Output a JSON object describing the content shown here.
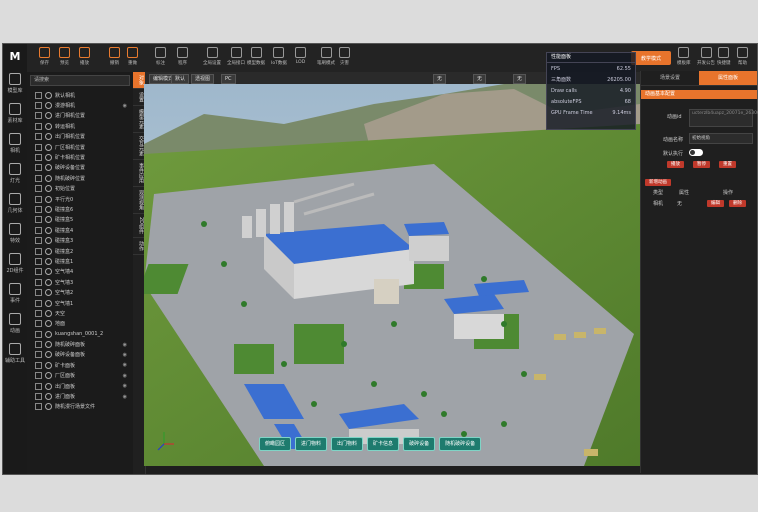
{
  "brand": {
    "logo": "M"
  },
  "rail": [
    {
      "label": "模型库",
      "icon": "cube-icon"
    },
    {
      "label": "素材库",
      "icon": "box-icon"
    },
    {
      "label": "相机",
      "icon": "camera-icon"
    },
    {
      "label": "灯光",
      "icon": "light-icon"
    },
    {
      "label": "几何体",
      "icon": "shape-icon"
    },
    {
      "label": "特效",
      "icon": "effect-icon"
    },
    {
      "label": "2D组件",
      "icon": "widget-icon"
    },
    {
      "label": "事件",
      "icon": "event-icon"
    },
    {
      "label": "动画",
      "icon": "animation-icon"
    },
    {
      "label": "辅助工具",
      "icon": "tool-icon"
    }
  ],
  "toolbar": {
    "items": [
      "保存",
      "预览",
      "播放",
      "撤销",
      "重做",
      "标注",
      "程序",
      "全局设置",
      "全局接口",
      "模型数据",
      "IoT数据",
      "LOD",
      "笔刷模式",
      "灾害"
    ],
    "teach_mode": "教学模式",
    "right_items": [
      "模板库",
      "开发公告",
      "快捷键",
      "帮助"
    ]
  },
  "tree": {
    "search_placeholder": "请搜索",
    "rows": [
      {
        "label": "默认相机",
        "eye": false
      },
      {
        "label": "漫游相机",
        "eye": true
      },
      {
        "label": "进门相机位置",
        "eye": false
      },
      {
        "label": "转运相机",
        "eye": false
      },
      {
        "label": "出门相机位置",
        "eye": false
      },
      {
        "label": "厂区相机位置",
        "eye": false
      },
      {
        "label": "矿卡相机位置",
        "eye": false
      },
      {
        "label": "破碎设备位置",
        "eye": false
      },
      {
        "label": "随机破碎位置",
        "eye": false
      },
      {
        "label": "初始位置",
        "eye": false
      },
      {
        "label": "平行光0",
        "eye": false
      },
      {
        "label": "碰撞盒6",
        "eye": false
      },
      {
        "label": "碰撞盒5",
        "eye": false
      },
      {
        "label": "碰撞盒4",
        "eye": false
      },
      {
        "label": "碰撞盒3",
        "eye": false
      },
      {
        "label": "碰撞盒2",
        "eye": false
      },
      {
        "label": "碰撞盒1",
        "eye": false
      },
      {
        "label": "空气墙4",
        "eye": false
      },
      {
        "label": "空气墙3",
        "eye": false
      },
      {
        "label": "空气墙2",
        "eye": false
      },
      {
        "label": "空气墙1",
        "eye": false
      },
      {
        "label": "天空",
        "eye": false
      },
      {
        "label": "地面",
        "eye": false
      },
      {
        "label": "kuangshan_0001_2",
        "eye": false
      },
      {
        "label": "随机破碎面板",
        "eye": true
      },
      {
        "label": "破碎设备面板",
        "eye": true
      },
      {
        "label": "矿卡面板",
        "eye": true
      },
      {
        "label": "厂区面板",
        "eye": true
      },
      {
        "label": "出门面板",
        "eye": true
      },
      {
        "label": "进门面板",
        "eye": true
      },
      {
        "label": "随机漫行场景文件",
        "eye": false
      }
    ]
  },
  "vtabs": [
    "对象",
    "设置",
    "模型元素",
    "交互元素",
    "事件应用",
    "观测视角",
    "2D组件",
    "动作"
  ],
  "viewbar": {
    "items": [
      "编辑模式",
      "默认",
      "透视图",
      "PC"
    ],
    "right_labels": [
      "无",
      "无",
      "无"
    ]
  },
  "stats": {
    "title": "性能面板",
    "rows": [
      {
        "k": "FPS",
        "v": "62.55"
      },
      {
        "k": "三角面数",
        "v": "26205.00"
      },
      {
        "k": "Draw calls",
        "v": "4.90"
      },
      {
        "k": "absoluteFPS",
        "v": "68"
      },
      {
        "k": "GPU Frame Time",
        "v": "9.14ms"
      }
    ]
  },
  "nav_buttons": [
    "俯瞰园区",
    "进门物料",
    "出门物料",
    "矿卡信息",
    "破碎设备",
    "随机破碎设备"
  ],
  "props": {
    "tabs": [
      "场景设置",
      "属性面板"
    ],
    "section": "动画基本配置",
    "anim_id_label": "动画id",
    "anim_id_value": "ucterzIb4uapz_20071e_2630682",
    "anim_name_label": "动画名称",
    "anim_name_value": "初始视角",
    "default_exec_label": "默认执行",
    "action_buttons": [
      "播放",
      "暂停",
      "重置"
    ],
    "add_anim": "新增动画",
    "table_headers": [
      "类型",
      "属性",
      "操作"
    ],
    "table_row": {
      "type": "相机",
      "attr": "无",
      "ops": [
        "编辑",
        "删除"
      ]
    }
  },
  "colors": {
    "accent": "#e8742c",
    "panel": "#1f1f1f",
    "nav_btn": "#1e7b6e"
  }
}
